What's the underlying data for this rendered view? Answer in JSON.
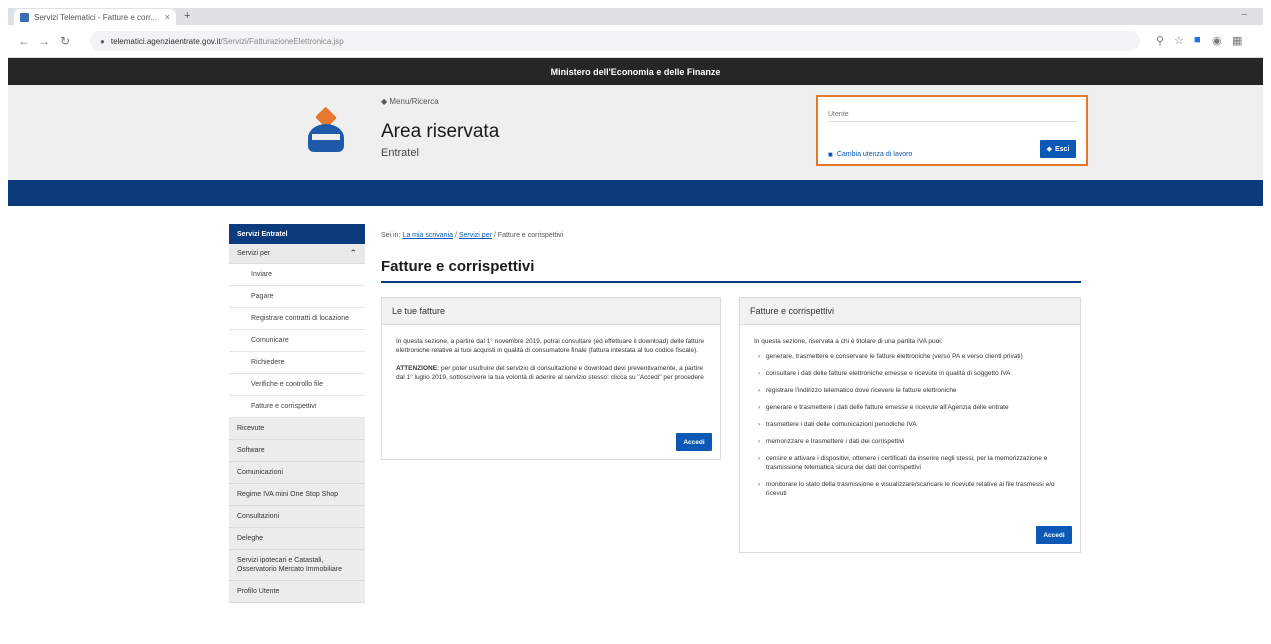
{
  "browser": {
    "tab_title": "Servizi Telematici - Fatture e corr...",
    "tab_close": "×",
    "new_tab": "+",
    "window_min": "–",
    "url_host": "telematici.agenziaentrate.gov.it",
    "url_path": "/Servizi/FatturazioneElettronica.jsp",
    "icons": [
      "back-icon",
      "forward-icon",
      "reload-icon",
      "lock-icon",
      "zoom-icon",
      "star-icon",
      "extension-icon",
      "profile-icon",
      "menu-icon"
    ]
  },
  "ministry": {
    "label": "Ministero dell'Economia e delle Finanze"
  },
  "header": {
    "back_link": "◆ Menu/Ricerca",
    "title": "Area riservata",
    "subtitle": "Entratel"
  },
  "userbox": {
    "label": "Utente",
    "change_link": "Cambia utenza di lavoro",
    "exit_label": "Esci",
    "exit_icon": "◆"
  },
  "sidebar": {
    "heading": "Servizi Entratel",
    "group": {
      "label": "Servizi per",
      "chevron": "⌃"
    },
    "subitems": [
      "Inviare",
      "Pagare",
      "Registrare contratti di locazione",
      "Comunicare",
      "Richiedere",
      "Verifiche e controllo file",
      "Fatture e corrispettivi"
    ],
    "items": [
      "Ricevute",
      "Software",
      "Comunicazioni",
      "Regime IVA mini One Stop Shop",
      "Consultazioni",
      "Deleghe",
      "Servizi ipotecari e Catastali, Osservatorio Mercato Immobiliare",
      "Profilo Utente"
    ]
  },
  "breadcrumb": {
    "prefix": "Sei in:",
    "link1": "La mia scrivania",
    "link2": "Servizi per",
    "sep": "/",
    "current": "Fatture e corrispettivi"
  },
  "page_title": "Fatture e corrispettivi",
  "panel_left": {
    "title": "Le tue fatture",
    "para1": "In questa sezione, a partire dal 1° novembre 2019, potrai consultare (ed effettuare il download) delle fatture elettroniche relative ai tuoi acquisti in qualità di consumatore finale (fattura intestata al tuo codice fiscale).",
    "para2_bold": "ATTENZIONE:",
    "para2": " per poter usufruire del servizio di consultazione e download devi preventivamente, a partire dal 1° luglio 2019, sottoscrivere la tua volontà di aderire al servizio stesso: clicca su \"Accedi\" per procedere",
    "button": "Accedi"
  },
  "panel_right": {
    "title": "Fatture e corrispettivi",
    "intro": "In questa sezione, riservata a chi è titolare di una partita IVA puoi:",
    "items": [
      "generare, trasmettere e conservare le fatture elettroniche (verso PA e verso clienti privati)",
      "consultare i dati delle fatture elettroniche emesse e ricevute in qualità di soggetto IVA",
      "registrare l'indirizzo telematico dove ricevere le fatture elettroniche",
      "generare e trasmettere i dati delle fatture emesse e ricevute all'Agenzia delle entrate",
      "trasmettere i dati delle comunicazioni periodiche IVA",
      "memorizzare e trasmettere i dati dei corrispettivi",
      "censire e attivare i dispositivi, ottenere i certificati da inserire negli stessi, per la memorizzazione e trasmissione telematica sicura dei dati dei corrispettivi",
      "monitorare lo stato della trasmissione e visualizzare/scaricare le ricevute relative ai file trasmessi e/o ricevuti"
    ],
    "button": "Accedi"
  }
}
